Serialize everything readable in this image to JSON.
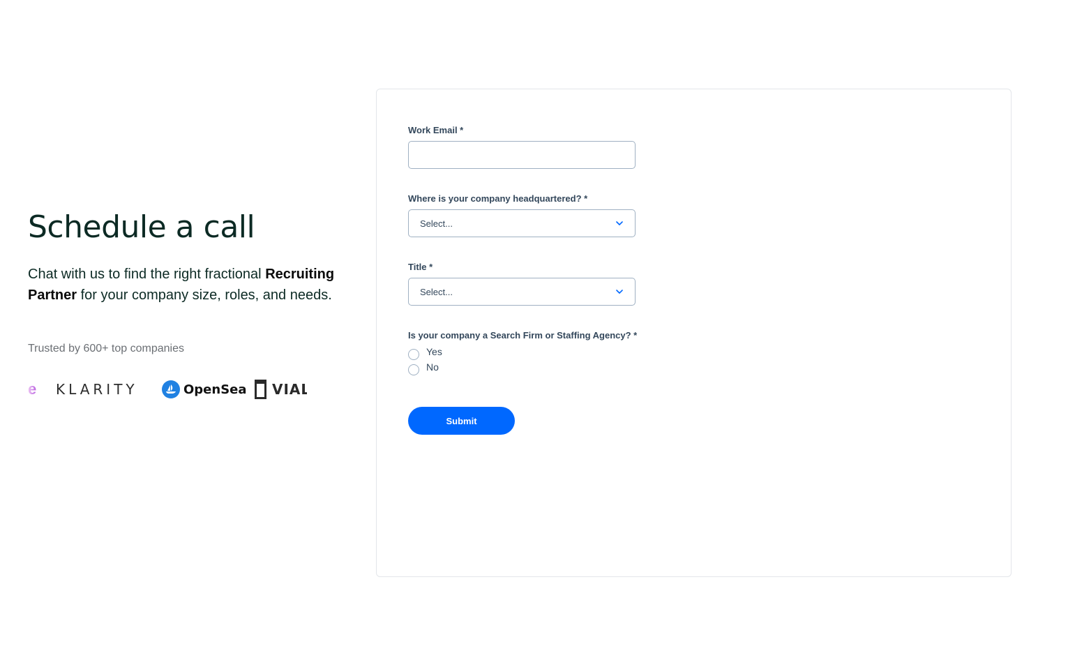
{
  "intro": {
    "title": "Schedule a call",
    "subtitle_pre": "Chat with us to find the right fractional ",
    "subtitle_bold": "Recruiting Partner",
    "subtitle_post": " for your company size, roles, and needs.",
    "trusted": "Trusted by 600+ top companies"
  },
  "logos": {
    "e": "e",
    "klarity": "KLARITY",
    "opensea": "OpenSea",
    "vial": "VIAL"
  },
  "form": {
    "email_label": "Work Email *",
    "email_value": "",
    "hq_label": "Where is your company headquartered? *",
    "hq_selected": "Select...",
    "title_label": "Title *",
    "title_selected": "Select...",
    "agency_label": "Is your company a Search Firm or Staffing Agency? *",
    "agency_options": [
      "Yes",
      "No"
    ],
    "submit_label": "Submit"
  },
  "colors": {
    "accent": "#0068ff",
    "heading": "#0c2a24",
    "form_text": "#33475b"
  }
}
